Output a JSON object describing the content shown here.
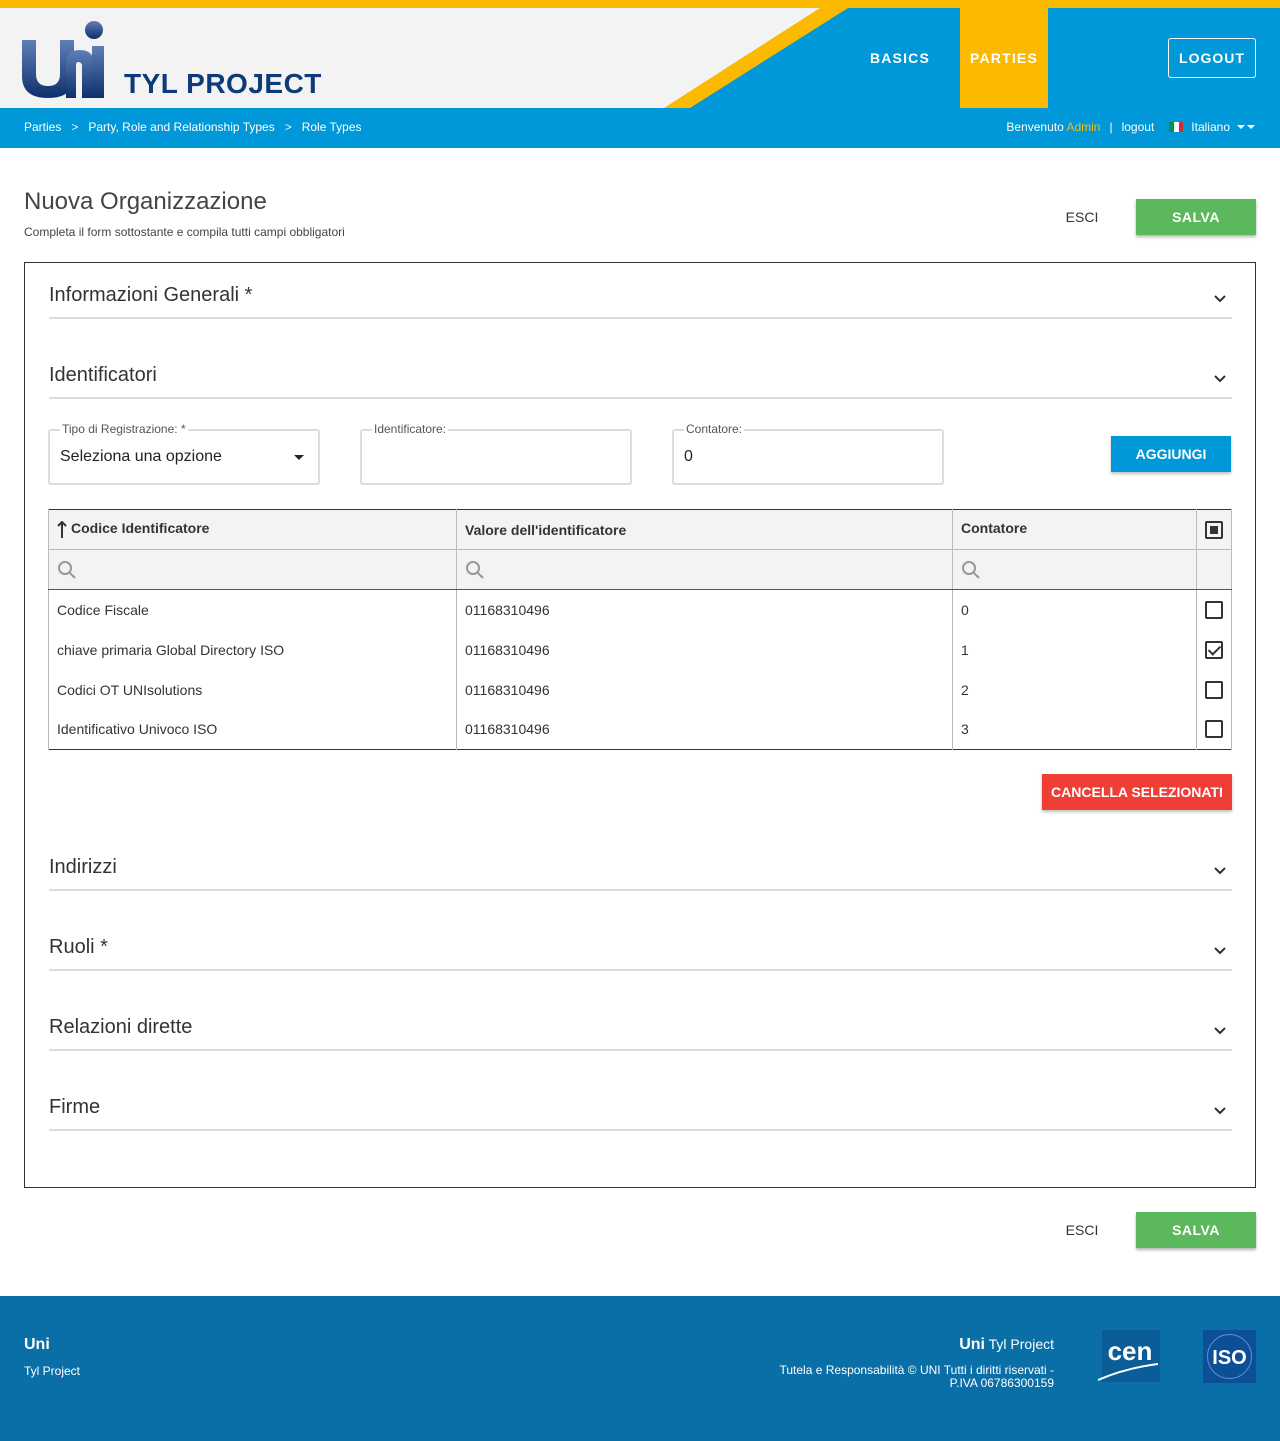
{
  "header": {
    "brand": "TYL PROJECT",
    "nav": [
      "BASICS",
      "PARTIES"
    ],
    "logout": "LOGOUT"
  },
  "breadcrumb": [
    "Parties",
    "Party, Role and Relationship Types",
    "Role Types"
  ],
  "breadcrumb_sep": ">",
  "user": {
    "welcome": "Benvenuto",
    "name": "Admin",
    "divider": "|",
    "logout_link": "logout",
    "language": "Italiano"
  },
  "page": {
    "title": "Nuova Organizzazione",
    "subtitle": "Completa il form sottostante e compila tutti campi obbligatori",
    "esci": "ESCI",
    "salva": "SALVA"
  },
  "sections": {
    "info": "Informazioni Generali *",
    "identificatori": "Identificatori",
    "indirizzi": "Indirizzi",
    "ruoli": "Ruoli *",
    "relazioni": "Relazioni dirette",
    "firme": "Firme"
  },
  "form": {
    "tipo_label": "Tipo di Registrazione: *",
    "tipo_value": "Seleziona una opzione",
    "ident_label": "Identificatore:",
    "ident_value": "",
    "cont_label": "Contatore:",
    "cont_value": "0",
    "add_button": "AGGIUNGI"
  },
  "table": {
    "columns": [
      "Codice Identificatore",
      "Valore dell'identificatore",
      "Contatore"
    ],
    "rows": [
      {
        "code": "Codice Fiscale",
        "value": "01168310496",
        "count": "0",
        "checked": false
      },
      {
        "code": "chiave primaria Global Directory ISO",
        "value": "01168310496",
        "count": "1",
        "checked": true
      },
      {
        "code": "Codici OT UNIsolutions",
        "value": "01168310496",
        "count": "2",
        "checked": false
      },
      {
        "code": "Identificativo Univoco ISO",
        "value": "01168310496",
        "count": "3",
        "checked": false
      }
    ],
    "delete_button": "CANCELLA SELEZIONATI"
  },
  "footer": {
    "uni": "Uni",
    "tyl": "Tyl Project",
    "brand_bold": "Uni",
    "brand_rest": "Tyl Project",
    "legal_a": "Tutela e Responsabilità",
    "legal_b": "© UNI Tutti i diritti riservati - P.IVA 06786300159"
  },
  "colors": {
    "yellow": "#fbb900",
    "blue": "#0098d8",
    "green": "#5cb85c",
    "red": "#ef3e36",
    "footer": "#0a6fa7"
  }
}
